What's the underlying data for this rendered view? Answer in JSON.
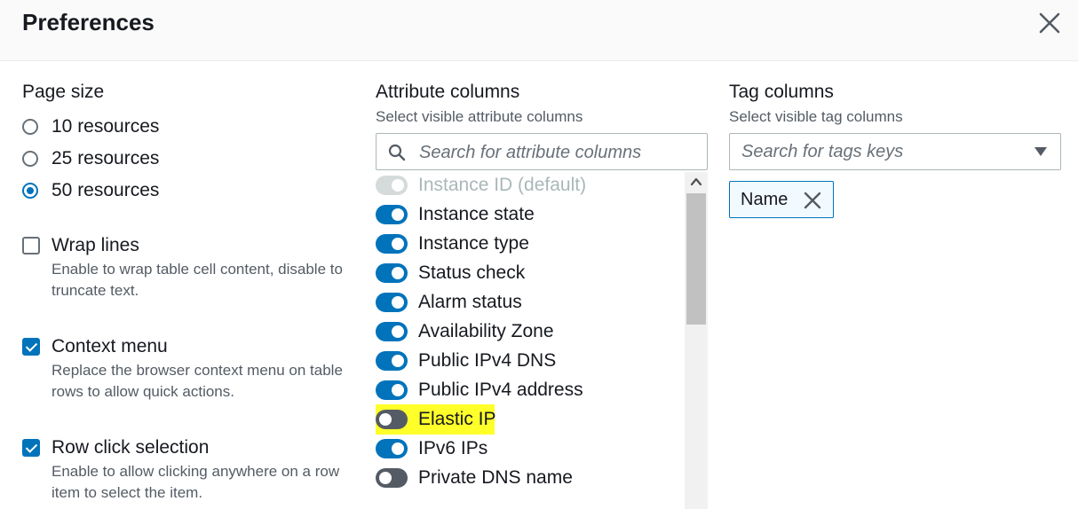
{
  "dialog": {
    "title": "Preferences"
  },
  "page_size": {
    "title": "Page size",
    "options": [
      {
        "label": "10 resources",
        "selected": false
      },
      {
        "label": "25 resources",
        "selected": false
      },
      {
        "label": "50 resources",
        "selected": true
      }
    ]
  },
  "options": [
    {
      "label": "Wrap lines",
      "checked": false,
      "description": "Enable to wrap table cell content, disable to truncate text."
    },
    {
      "label": "Context menu",
      "checked": true,
      "description": "Replace the browser context menu on table rows to allow quick actions."
    },
    {
      "label": "Row click selection",
      "checked": true,
      "description": "Enable to allow clicking anywhere on a row item to select the item."
    }
  ],
  "attribute_columns": {
    "title": "Attribute columns",
    "subtitle": "Select visible attribute columns",
    "search_placeholder": "Search for attribute columns",
    "items": [
      {
        "label": "Instance ID (default)",
        "state": "disabled"
      },
      {
        "label": "Instance state",
        "state": "on"
      },
      {
        "label": "Instance type",
        "state": "on"
      },
      {
        "label": "Status check",
        "state": "on"
      },
      {
        "label": "Alarm status",
        "state": "on"
      },
      {
        "label": "Availability Zone",
        "state": "on"
      },
      {
        "label": "Public IPv4 DNS",
        "state": "on"
      },
      {
        "label": "Public IPv4 address",
        "state": "on"
      },
      {
        "label": "Elastic IP",
        "state": "off",
        "highlighted": true
      },
      {
        "label": "IPv6 IPs",
        "state": "on"
      },
      {
        "label": "Private DNS name",
        "state": "off"
      }
    ]
  },
  "tag_columns": {
    "title": "Tag columns",
    "subtitle": "Select visible tag columns",
    "search_placeholder": "Search for tags keys",
    "tokens": [
      {
        "label": "Name"
      }
    ]
  },
  "colors": {
    "accent": "#0073bb",
    "toggle_off": "#545b64",
    "toggle_disabled": "#d5dbdb",
    "highlight": "#ffff2a"
  }
}
